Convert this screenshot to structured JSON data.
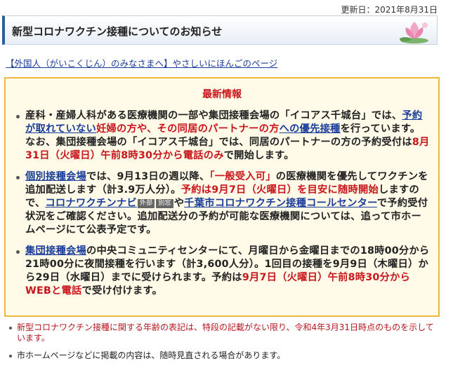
{
  "updated": "更新日：2021年8月31日",
  "title": "新型コロナワクチン接種についてのお知らせ",
  "foreign_link": "【外国人（がいこくじん）のみなさまへ】やさしいにほんごのページ",
  "news": {
    "heading": "最新情報",
    "item1": {
      "t1": "産科・産婦人科がある医療機関の一部や集団接種会場の「イコアス千城台」では、",
      "l1": "予約が取れていない",
      "t2": "妊婦の方や、その同居のパートナーの方",
      "l2": "への優先接種",
      "t3": "を行っています。なお、集団接種会場の「イコアス千城台」では、同居のパートナーの方の予約受付は",
      "r1": "8月31日（火曜日）午前8時30分から電話のみ",
      "t4": "で開始します。"
    },
    "item2": {
      "l1": "個別接種会場",
      "t1": "では、9月13日の週以降、",
      "r1": "「一般受入可」",
      "t2": "の医療機関を優先してワクチンを追加配送します（計3.9万人分）。",
      "r2": "予約は9月7日（火曜日）を目安に随時開始",
      "t3": "しますので、",
      "l2": "コロナワクチンナビ",
      "badge1": "外部",
      "badge2": "別窓",
      "t4": "や",
      "l3": "千葉市コロナワクチン接種コールセンター",
      "t5": "で予約受付状況をご確認ください。追加配送分の予約が可能な医療機関については、追って市ホームページにて公表予定です。"
    },
    "item3": {
      "l1": "集団接種会場",
      "t1": "の中央コミュニティセンターにて、月曜日から金曜日までの18時00分から21時00分に夜間接種を行います（計3,600人分）。1回目の接種を9月9日（木曜日）から29日（水曜日）までに受けられます。予約は",
      "r1": "9月7日（火曜日）午前8時30分からWEBと電話",
      "t2": "で受け付けます。"
    }
  },
  "notes": [
    "新型コロナワクチン接種に関する年齢の表記は、特段の記載がない限り、令和4年3月31日時点のものを示しています。",
    "市ホームページなどに掲載の内容は、随時見直される場合があります。"
  ],
  "icons": {
    "header": "lotus-flower-icon",
    "bullet": "bullet-dot-icon",
    "external": "external-link-icon",
    "new_window": "new-window-icon"
  },
  "colors": {
    "accent_red": "#c8161d",
    "link_blue": "#1a3d9a",
    "news_border": "#f0b83a",
    "news_bg": "#fffbe8"
  }
}
